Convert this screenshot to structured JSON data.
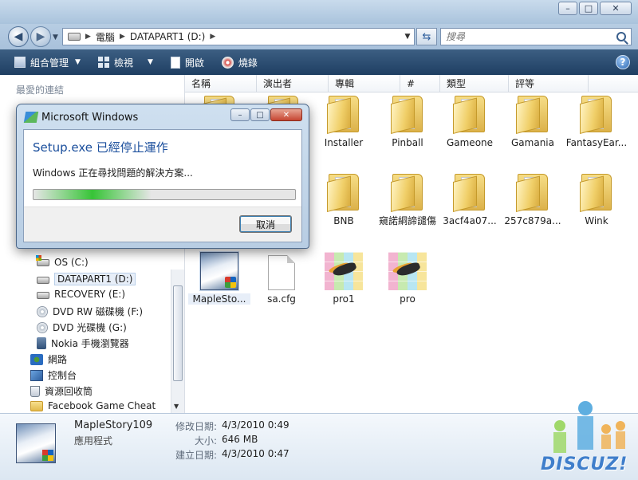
{
  "explorer": {
    "address": {
      "crumbs": [
        "電腦",
        "DATAPART1 (D:)"
      ]
    },
    "search": {
      "placeholder": "搜尋"
    },
    "toolbar": {
      "organize": "組合管理",
      "views": "檢視",
      "open": "開啟",
      "burn": "燒錄"
    },
    "nav": {
      "favorites_title": "最愛的連結",
      "tree": [
        {
          "label": "OS (C:)",
          "icon": "hdd-windows-icon"
        },
        {
          "label": "DATAPART1 (D:)",
          "icon": "hdd-icon",
          "selected": true
        },
        {
          "label": "RECOVERY (E:)",
          "icon": "hdd-icon"
        },
        {
          "label": "DVD RW 磁碟機 (F:)",
          "icon": "dvd-drive-icon"
        },
        {
          "label": "DVD 光碟機 (G:)",
          "icon": "dvd-drive-icon"
        },
        {
          "label": "Nokia 手機瀏覽器",
          "icon": "phone-icon"
        },
        {
          "label": "網路",
          "icon": "network-icon"
        },
        {
          "label": "控制台",
          "icon": "control-panel-icon"
        },
        {
          "label": "資源回收筒",
          "icon": "recycle-bin-icon"
        },
        {
          "label": "Facebook Game Cheat",
          "icon": "folder-icon"
        }
      ]
    },
    "columns": [
      "名稱",
      "演出者",
      "專輯",
      "#",
      "類型",
      "評等"
    ],
    "files": [
      {
        "label": "Installer",
        "type": "folder"
      },
      {
        "label": "Pinball",
        "type": "folder"
      },
      {
        "label": "Gameone",
        "type": "folder"
      },
      {
        "label": "Gamania",
        "type": "folder"
      },
      {
        "label": "FantasyEar...",
        "type": "folder"
      },
      {
        "label": "BNB",
        "type": "folder"
      },
      {
        "label": "窺諾絧諦譴傷",
        "type": "folder"
      },
      {
        "label": "3acf4a07...",
        "type": "folder"
      },
      {
        "label": "257c879a...",
        "type": "folder"
      },
      {
        "label": "Wink",
        "type": "folder"
      },
      {
        "label": "MapleSto...",
        "type": "application"
      },
      {
        "label": "sa.cfg",
        "type": "document"
      },
      {
        "label": "pro1",
        "type": "image"
      },
      {
        "label": "pro",
        "type": "image"
      }
    ],
    "details": {
      "name": "MapleStory109",
      "type": "應用程式",
      "modified_label": "修改日期:",
      "modified": "4/3/2010 0:49",
      "size_label": "大小:",
      "size": "646 MB",
      "created_label": "建立日期:",
      "created": "4/3/2010 0:47"
    },
    "watermark": "DISCUZ!"
  },
  "dialog": {
    "title": "Microsoft Windows",
    "heading": "Setup.exe 已經停止運作",
    "message": "Windows 正在尋找問題的解決方案...",
    "cancel": "取消",
    "progress": 0.45
  }
}
